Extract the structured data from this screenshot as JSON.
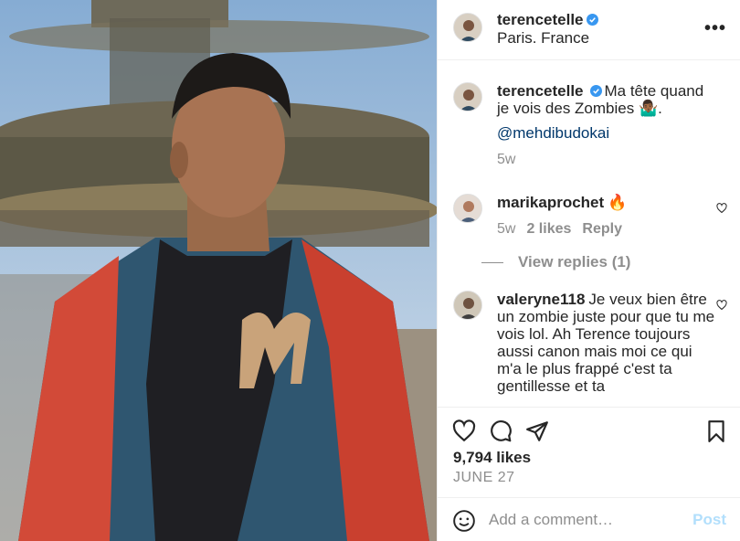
{
  "post": {
    "author": "terencetelle",
    "location": "Paris. France",
    "more_icon": "more-horizontal-icon",
    "more_label": "•••"
  },
  "comments": [
    {
      "user": "terencetelle",
      "verified": true,
      "text": "Ma tête quand je vois des Zombies 🤷🏾‍♂️.",
      "mention": "@mehdibudokai",
      "time": "5w"
    },
    {
      "user": "marikaprochet",
      "text": "🔥",
      "time": "5w",
      "likes": "2 likes",
      "reply": "Reply",
      "view_replies": "View replies (1)"
    },
    {
      "user": "valeryne118",
      "text": "Je veux bien être un zombie juste pour que tu me vois lol. Ah Terence toujours aussi canon mais moi ce qui m'a le plus frappé c'est ta gentillesse et ta"
    }
  ],
  "actions": {
    "likes": "9,794 likes",
    "date": "JUNE 27",
    "icons": [
      "heart-icon",
      "comment-icon",
      "share-icon",
      "bookmark-icon"
    ]
  },
  "add_comment": {
    "placeholder": "Add a comment…",
    "post_label": "Post"
  },
  "colors": {
    "verified": "#3897f0",
    "post_disabled": "#b2dffc",
    "muted": "#8e8e8e",
    "link": "#00376b"
  }
}
